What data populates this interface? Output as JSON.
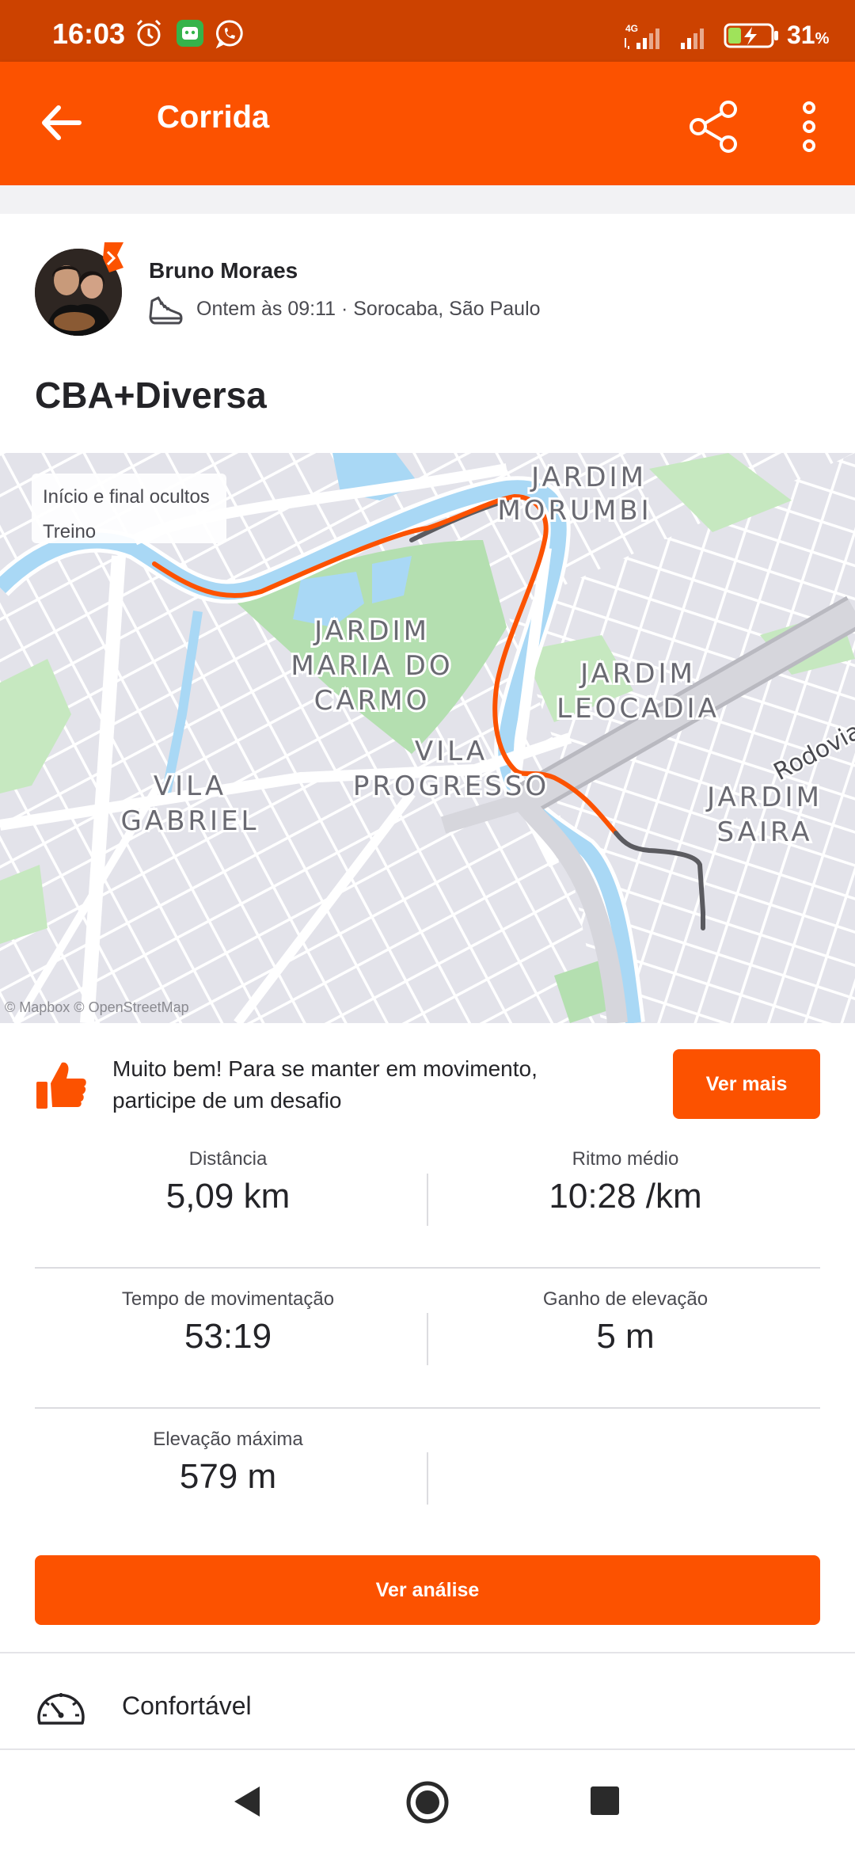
{
  "status_bar": {
    "time": "16:03",
    "network": "4G",
    "battery_percent": "31",
    "battery_unit": "%",
    "icons": [
      "alarm-icon",
      "app-bot-icon",
      "whatsapp-icon",
      "signal-icon",
      "signal-icon",
      "battery-charging-icon"
    ]
  },
  "app_bar": {
    "title": "Corrida",
    "icons": [
      "back-arrow-icon",
      "share-icon",
      "more-vertical-icon"
    ]
  },
  "activity": {
    "athlete_name": "Bruno Moraes",
    "meta": "Ontem às 09:11 · Sorocaba, São Paulo",
    "title": "CBA+Diversa",
    "activity_icon": "running-shoe-icon"
  },
  "map": {
    "legend_line1": "Início e final ocultos",
    "legend_line2": "Treino",
    "attribution": "© Mapbox © OpenStreetMap",
    "labels": {
      "jardim_morumbi_1": "JARDIM",
      "jardim_morumbi_2": "MORUMBI",
      "maria_1": "JARDIM",
      "maria_2": "MARIA DO",
      "maria_3": "CARMO",
      "leocadia_1": "JARDIM",
      "leocadia_2": "LEOCADIA",
      "rodovia": "Rodovia",
      "progresso_1": "VILA",
      "progresso_2": "PROGRESSO",
      "gabriel_1": "VILA",
      "gabriel_2": "GABRIEL",
      "saira_1": "JARDIM",
      "saira_2": "SAIRA"
    },
    "route_color": "#fc5200",
    "hidden_route_color": "#5b5b60"
  },
  "challenge": {
    "text": "Muito bem! Para se manter em movimento, participe de um desafio",
    "button_label": "Ver mais"
  },
  "stats": {
    "distance": {
      "label": "Distância",
      "value": "5,09 km"
    },
    "pace": {
      "label": "Ritmo médio",
      "value": "10:28 /km"
    },
    "moving_time": {
      "label": "Tempo de movimentação",
      "value": "53:19"
    },
    "elevation_gain": {
      "label": "Ganho de elevação",
      "value": "5 m"
    },
    "max_elevation": {
      "label": "Elevação máxima",
      "value": "579 m"
    }
  },
  "analysis_button": "Ver análise",
  "perceived_exertion": "Confortável",
  "colors": {
    "accent": "#fc5200",
    "status_bar": "#cc4200"
  }
}
